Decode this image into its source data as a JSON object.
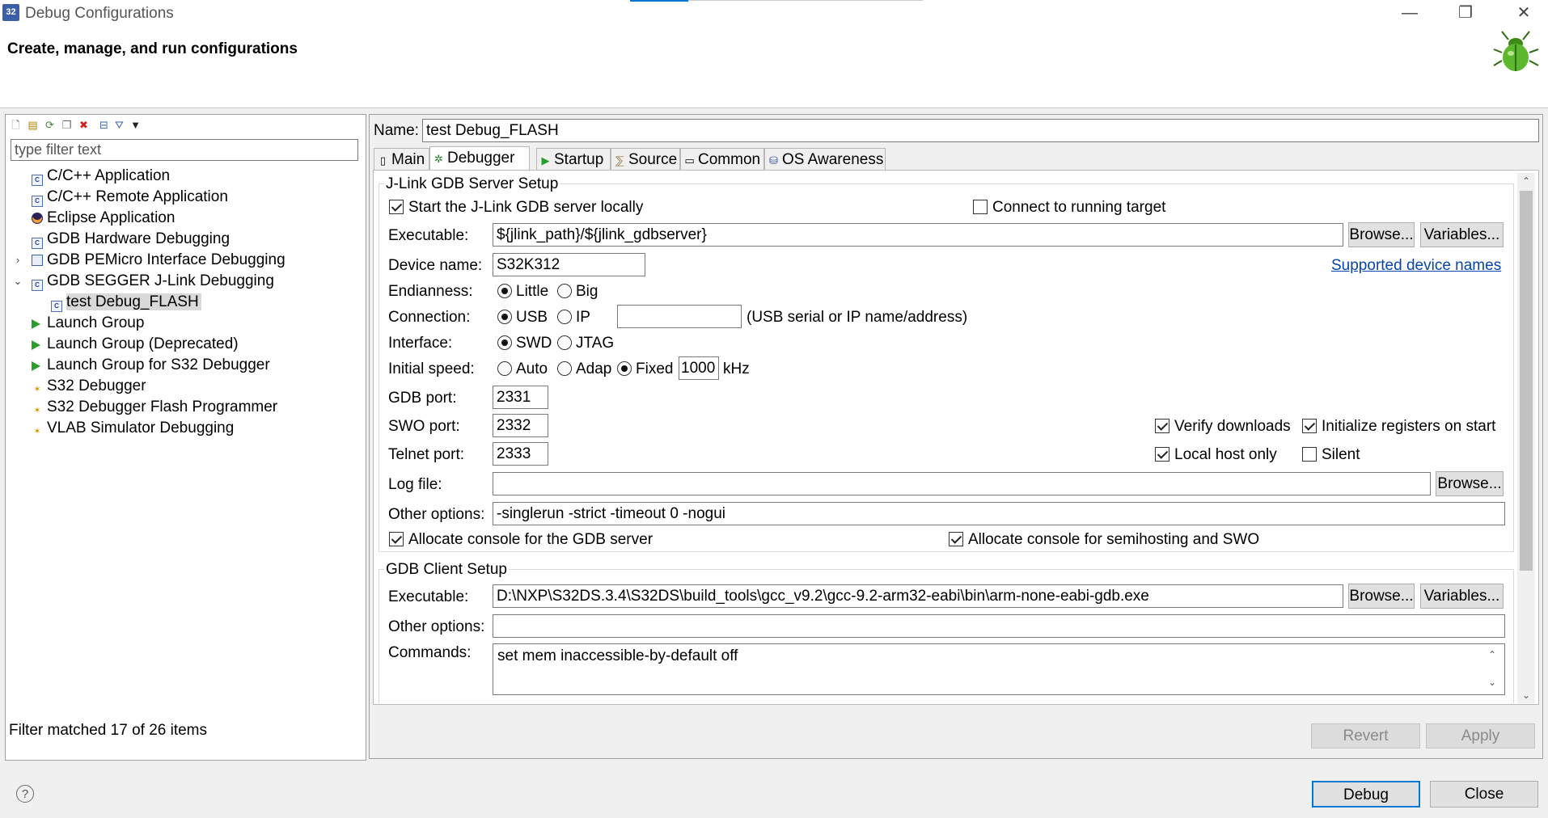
{
  "window": {
    "title": "Debug Configurations",
    "minimize": "—",
    "restore": "❐",
    "close": "✕"
  },
  "header": {
    "heading": "Create, manage, and run configurations"
  },
  "left": {
    "filter_placeholder": "type filter text",
    "tree": [
      {
        "label": "C/C++ Application"
      },
      {
        "label": "C/C++ Remote Application"
      },
      {
        "label": "Eclipse Application"
      },
      {
        "label": "GDB Hardware Debugging"
      },
      {
        "label": "GDB PEMicro Interface Debugging"
      },
      {
        "label": "GDB SEGGER J-Link Debugging"
      },
      {
        "label": "test Debug_FLASH"
      },
      {
        "label": "Launch Group"
      },
      {
        "label": "Launch Group (Deprecated)"
      },
      {
        "label": "Launch Group for S32 Debugger"
      },
      {
        "label": "S32 Debugger"
      },
      {
        "label": "S32 Debugger Flash Programmer"
      },
      {
        "label": "VLAB Simulator Debugging"
      }
    ],
    "status": "Filter matched 17 of 26 items"
  },
  "config": {
    "name_label": "Name:",
    "name_value": "test Debug_FLASH",
    "tabs": [
      {
        "label": "Main"
      },
      {
        "label": "Debugger"
      },
      {
        "label": "Startup"
      },
      {
        "label": "Source"
      },
      {
        "label": "Common"
      },
      {
        "label": "OS Awareness"
      }
    ],
    "server": {
      "title": "J-Link GDB Server Setup",
      "start_locally": "Start the J-Link GDB server locally",
      "connect_running": "Connect to running target",
      "executable_label": "Executable:",
      "executable_value": "${jlink_path}/${jlink_gdbserver}",
      "browse": "Browse...",
      "variables": "Variables...",
      "device_label": "Device name:",
      "device_value": "S32K312",
      "supported_link": "Supported device names",
      "endianness_label": "Endianness:",
      "endian_little": "Little",
      "endian_big": "Big",
      "connection_label": "Connection:",
      "conn_usb": "USB",
      "conn_ip": "IP",
      "conn_value": "",
      "conn_hint": "(USB serial or IP name/address)",
      "interface_label": "Interface:",
      "if_swd": "SWD",
      "if_jtag": "JTAG",
      "speed_label": "Initial speed:",
      "speed_auto": "Auto",
      "speed_adap": "Adap",
      "speed_fixed": "Fixed",
      "speed_value": "1000",
      "speed_unit": "kHz",
      "gdb_port_label": "GDB port:",
      "gdb_port": "2331",
      "swo_port_label": "SWO port:",
      "swo_port": "2332",
      "telnet_port_label": "Telnet port:",
      "telnet_port": "2333",
      "verify_downloads": "Verify downloads",
      "init_registers": "Initialize registers on start",
      "local_host_only": "Local host only",
      "silent": "Silent",
      "log_label": "Log file:",
      "log_value": "",
      "other_label": "Other options:",
      "other_value": "-singlerun -strict -timeout 0 -nogui",
      "alloc_gdb": "Allocate console for the GDB server",
      "alloc_semi": "Allocate console for semihosting and SWO"
    },
    "client": {
      "title": "GDB Client Setup",
      "executable_label": "Executable:",
      "executable_value": "D:\\NXP\\S32DS.3.4\\S32DS\\build_tools\\gcc_v9.2\\gcc-9.2-arm32-eabi\\bin\\arm-none-eabi-gdb.exe",
      "browse": "Browse...",
      "variables": "Variables...",
      "other_label": "Other options:",
      "other_value": "",
      "commands_label": "Commands:",
      "commands_value": "set mem inaccessible-by-default off"
    },
    "revert": "Revert",
    "apply": "Apply"
  },
  "footer": {
    "help": "?",
    "debug": "Debug",
    "close": "Close"
  }
}
